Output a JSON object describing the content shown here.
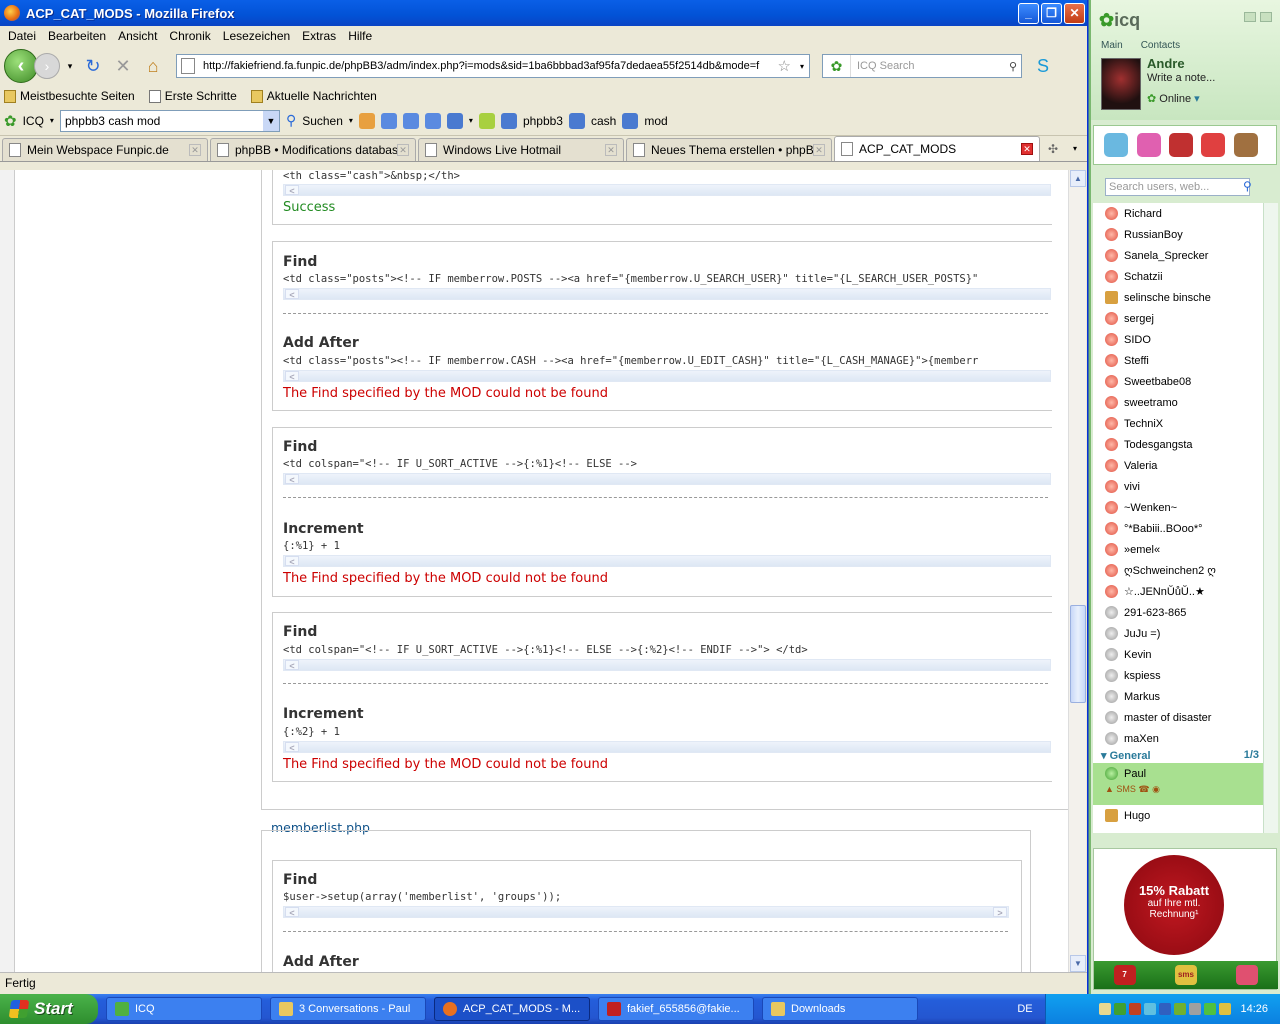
{
  "window": {
    "title": "ACP_CAT_MODS - Mozilla Firefox"
  },
  "menu": [
    "Datei",
    "Bearbeiten",
    "Ansicht",
    "Chronik",
    "Lesezeichen",
    "Extras",
    "Hilfe"
  ],
  "nav": {
    "url": "http://fakiefriend.fa.funpic.de/phpBB3/adm/index.php?i=mods&sid=1ba6bbbad3af95fa7dedaea55f2514db&mode=f",
    "search_placeholder": "ICQ Search"
  },
  "bookmarks": [
    "Meistbesuchte Seiten",
    "Erste Schritte",
    "Aktuelle Nachrichten"
  ],
  "icqbar": {
    "label": "ICQ",
    "query": "phpbb3 cash mod",
    "search_label": "Suchen",
    "tags": [
      "phpbb3",
      "cash",
      "mod"
    ]
  },
  "tabs": [
    "Mein Webspace Funpic.de",
    "phpBB • Modifications database",
    "Windows Live Hotmail",
    "Neues Thema erstellen • phpB...",
    "ACP_CAT_MODS"
  ],
  "page": {
    "top_code": "<th class=\"cash\">&nbsp;</th>",
    "success": "Success",
    "not_found": "The Find specified by the MOD could not be found",
    "find": "Find",
    "add_after": "Add After",
    "increment": "Increment",
    "b1_find": "<td class=\"posts\"><!-- IF memberrow.POSTS --><a href=\"{memberrow.U_SEARCH_USER}\" title=\"{L_SEARCH_USER_POSTS}\"",
    "b1_add": "<td class=\"posts\"><!-- IF memberrow.CASH --><a href=\"{memberrow.U_EDIT_CASH}\" title=\"{L_CASH_MANAGE}\">{memberr",
    "b2_find": "<td colspan=\"<!-- IF U_SORT_ACTIVE -->{:%1}<!-- ELSE -->",
    "b2_inc": "{:%1} + 1",
    "b3_find": "<td colspan=\"<!-- IF U_SORT_ACTIVE -->{:%1}<!-- ELSE -->{:%2}<!-- ENDIF -->\"> </td>",
    "b3_inc": "{:%2} + 1",
    "file": "memberlist.php",
    "b4_find": "$user->setup(array('memberlist', 'groups'));"
  },
  "status": "Fertig",
  "icq": {
    "logo": "icq",
    "tab_main": "Main",
    "tab_contacts": "Contacts",
    "user": "Andre",
    "note": "Write a note...",
    "status": "Online",
    "search_placeholder": "Search users, web...",
    "contacts_online": [
      "Richard",
      "RussianBoy",
      "Sanela_Sprecker",
      "Schatzii",
      "selinsche binsche",
      "sergej",
      "SIDO",
      "Steffi",
      "Sweetbabe08",
      "sweetramo",
      "TechniX",
      "Todesgangsta",
      "Valeria",
      "vivi",
      "~Wenken~",
      "°*Babiii..BOoo*°",
      "»emel«",
      "ღSchweinchen2 ღ",
      "☆..JENnŬůŬ..★"
    ],
    "contacts_offline": [
      "291-623-865",
      "JuJu =)",
      "Kevin",
      "kspiess",
      "Markus",
      "master of disaster",
      "maXen"
    ],
    "group": "General",
    "group_count": "1/3",
    "selected": "Paul",
    "after": [
      "Hugo"
    ],
    "ad_big": "15% Rabatt",
    "ad_small": "auf Ihre mtl. Rechnung¹"
  },
  "taskbar": {
    "start": "Start",
    "items": [
      "ICQ",
      "3 Conversations - Paul",
      "ACP_CAT_MODS - M...",
      "fakief_655856@fakie...",
      "Downloads"
    ],
    "lang": "DE",
    "time": "14:26"
  }
}
